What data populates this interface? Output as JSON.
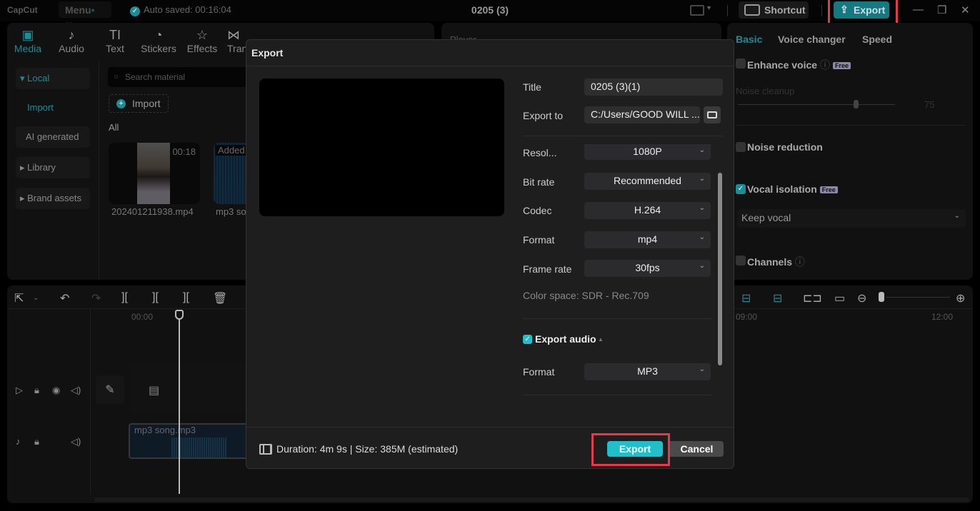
{
  "app": {
    "logo": "CapCut",
    "menu_label": "Menu",
    "autosave": "Auto saved: 00:16:04",
    "project_title": "0205 (3)",
    "shortcut_label": "Shortcut",
    "export_label": "Export"
  },
  "toolbar": {
    "tabs": [
      {
        "label": "Media",
        "icon": "media-icon"
      },
      {
        "label": "Audio",
        "icon": "audio-icon"
      },
      {
        "label": "Text",
        "icon": "text-icon"
      },
      {
        "label": "Stickers",
        "icon": "stickers-icon"
      },
      {
        "label": "Effects",
        "icon": "effects-icon"
      },
      {
        "label": "Tran",
        "icon": "transitions-icon"
      }
    ]
  },
  "media_sidebar": {
    "items": [
      {
        "label": "Local",
        "active": true
      },
      {
        "label": "Import",
        "active": true
      },
      {
        "label": "AI generated"
      },
      {
        "label": "Library"
      },
      {
        "label": "Brand assets"
      }
    ]
  },
  "media": {
    "search_placeholder": "Search material",
    "import_label": "Import",
    "filter_label": "All",
    "items": [
      {
        "name": "202401211938.mp4",
        "duration": "00:18"
      },
      {
        "name": "mp3 so",
        "badge": "Added"
      }
    ]
  },
  "player": {
    "label": "Player"
  },
  "timeline": {
    "ruler": [
      "00:00",
      "09:00",
      "12:00"
    ],
    "audio_clip": "mp3 song.mp3"
  },
  "right_panel": {
    "tabs": [
      "Basic",
      "Voice changer",
      "Speed"
    ],
    "enhance_voice": "Enhance voice",
    "free_badge": "Free",
    "noise_cleanup": "Noise cleanup",
    "noise_cleanup_value": "75",
    "noise_reduction": "Noise reduction",
    "vocal_isolation": "Vocal isolation",
    "vocal_option": "Keep vocal",
    "channels": "Channels"
  },
  "export_dialog": {
    "title": "Export",
    "fields": {
      "title_label": "Title",
      "title_value": "0205 (3)(1)",
      "export_to_label": "Export to",
      "export_to_value": "C:/Users/GOOD WILL ...",
      "resolution_label": "Resol...",
      "resolution_value": "1080P",
      "bitrate_label": "Bit rate",
      "bitrate_value": "Recommended",
      "codec_label": "Codec",
      "codec_value": "H.264",
      "format_label": "Format",
      "format_value": "mp4",
      "framerate_label": "Frame rate",
      "framerate_value": "30fps",
      "color_space": "Color space: SDR - Rec.709",
      "export_audio_label": "Export audio",
      "export_audio_checked": true,
      "audio_format_label": "Format",
      "audio_format_value": "MP3"
    },
    "footer": "Duration: 4m 9s | Size: 385M (estimated)",
    "export_button": "Export",
    "cancel_button": "Cancel"
  },
  "colors": {
    "accent": "#1fbfcc",
    "highlight": "#e8394b"
  }
}
